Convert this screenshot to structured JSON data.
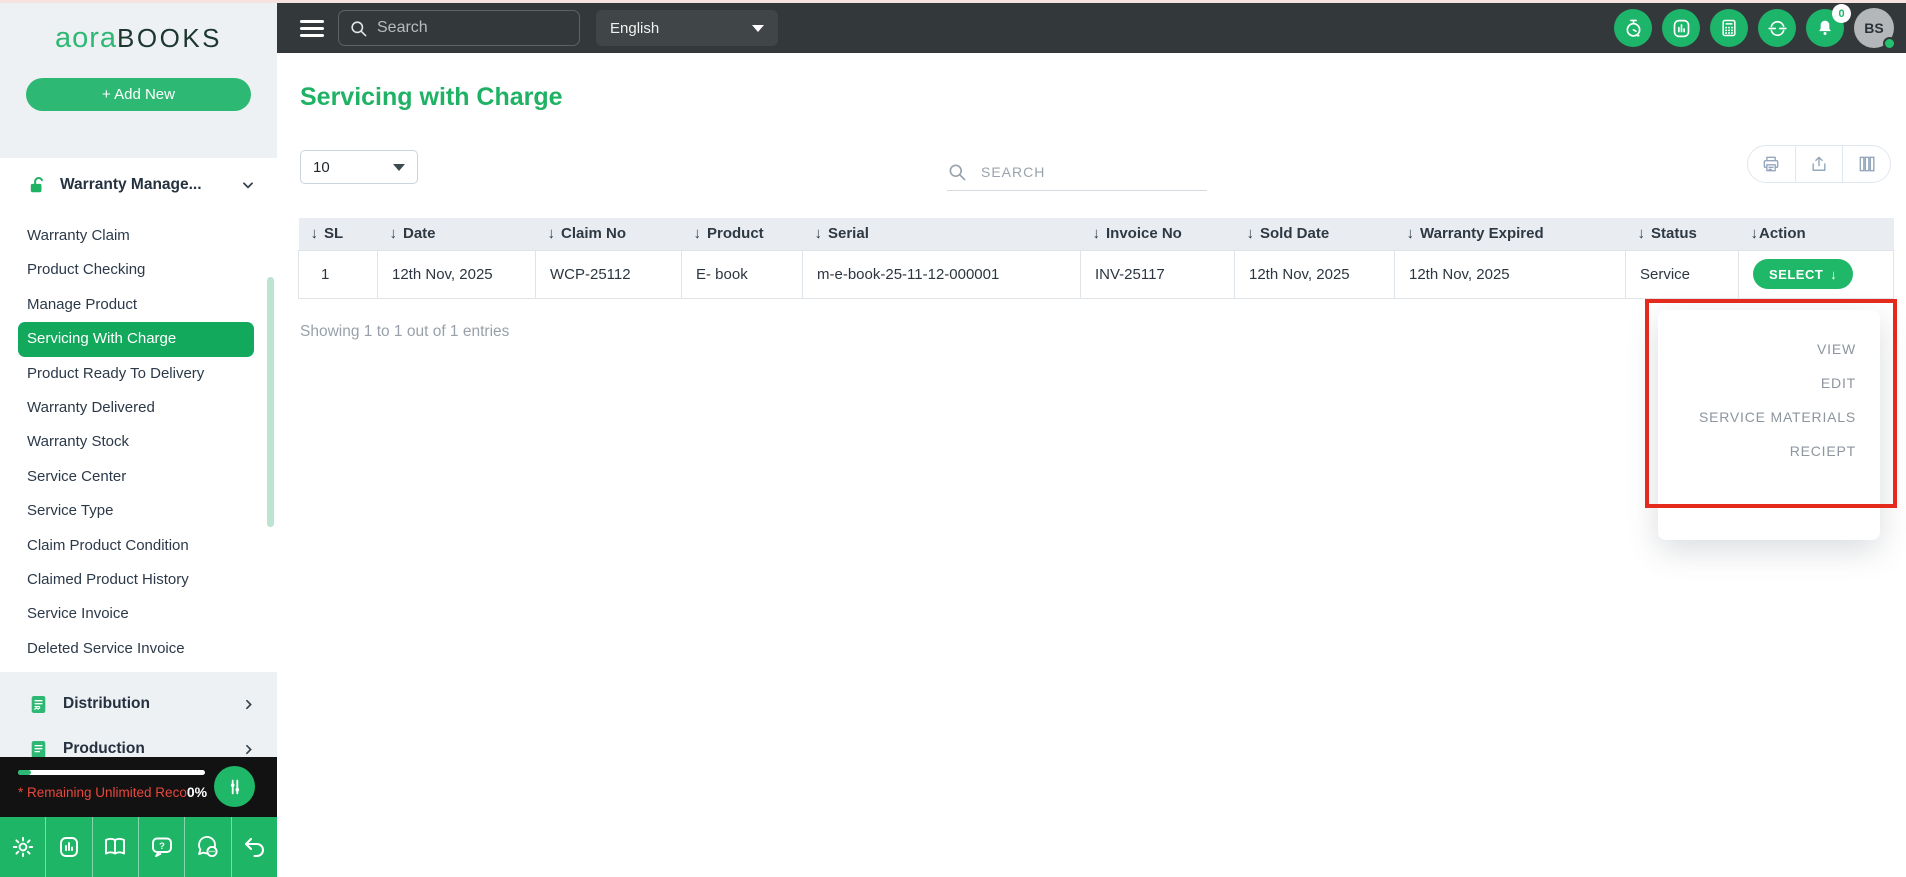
{
  "colors": {
    "accent": "#1fb768",
    "topbar_bg": "#33383a",
    "annotation_red": "#e42a1d",
    "active_item_bg": "#12a95d"
  },
  "icons": {
    "sort_arrow": "↓"
  },
  "brand": {
    "logo_primary": "aora",
    "logo_secondary": "BOOKS"
  },
  "topbar": {
    "search_placeholder": "Search",
    "language": "English",
    "notification_count": "0",
    "avatar_initials": "BS"
  },
  "sidebar": {
    "add_new": "+ Add New",
    "section_label": "Warranty Manage...",
    "items": [
      "Warranty Claim",
      "Product Checking",
      "Manage Product",
      "Servicing With Charge",
      "Product Ready To Delivery",
      "Warranty Delivered",
      "Warranty Stock",
      "Service Center",
      "Service Type",
      "Claim Product Condition",
      "Claimed Product History",
      "Service Invoice",
      "Deleted Service Invoice"
    ],
    "collapsed_sections": [
      "Distribution",
      "Production"
    ],
    "usage_note": "* Remaining Unlimited Reco",
    "usage_percent": "0%"
  },
  "main": {
    "title": "Servicing with Charge",
    "page_size": "10",
    "search_placeholder": "SEARCH",
    "table": {
      "headers": [
        "SL",
        "Date",
        "Claim No",
        "Product",
        "Serial",
        "Invoice No",
        "Sold Date",
        "Warranty Expired",
        "Status",
        "Action"
      ],
      "row": {
        "sl": "1",
        "date": "12th Nov, 2025",
        "claim_no": "WCP-25112",
        "product": "E- book",
        "serial": "m-e-book-25-11-12-000001",
        "invoice_no": "INV-25117",
        "sold_date": "12th Nov, 2025",
        "warranty_expired": "12th Nov, 2025",
        "status": "Service",
        "action": "SELECT"
      }
    },
    "showing_text": "Showing 1 to 1 out of 1 entries",
    "action_menu": [
      "VIEW",
      "EDIT",
      "SERVICE MATERIALS",
      "RECIEPT"
    ]
  }
}
